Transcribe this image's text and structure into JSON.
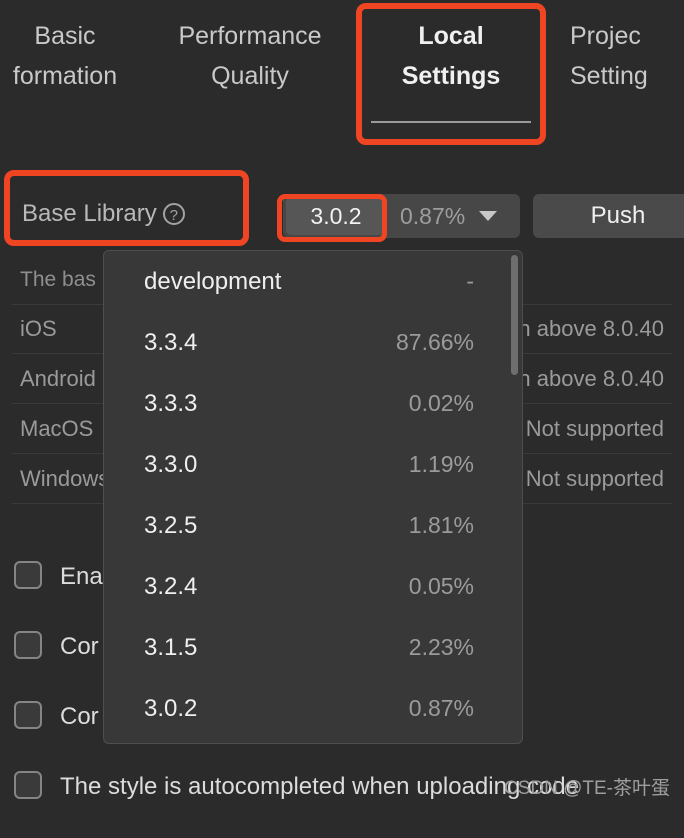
{
  "colors": {
    "background": "#2b2b2b",
    "panel": "#383838",
    "annotation_red": "#f04523",
    "button": "#4a4a4a",
    "chip": "#565656",
    "text_primary": "#efefef",
    "text_secondary": "#9b9b9b"
  },
  "tabs": [
    {
      "label_line1": "Basic",
      "label_line2": "formation",
      "active": false
    },
    {
      "label_line1": "Performance",
      "label_line2": "Quality",
      "active": false
    },
    {
      "label_line1": "Local",
      "label_line2": "Settings",
      "active": true
    },
    {
      "label_line1": "Projec",
      "label_line2": "Setting",
      "active": false
    }
  ],
  "base_library": {
    "label": "Base Library",
    "help_icon": "question-mark-circle-icon",
    "selected_version": "3.0.2",
    "selected_share": "0.87%",
    "caret_icon": "chevron-down-icon",
    "push_label": "Push"
  },
  "description": "The bas",
  "support_table": {
    "rows": [
      {
        "platform": "iOS",
        "support": "on above 8.0.40"
      },
      {
        "platform": "Android",
        "support": "on above 8.0.40"
      },
      {
        "platform": "MacOS",
        "support": "Not supported"
      },
      {
        "platform": "Windows",
        "support": "Not supported"
      }
    ]
  },
  "checkboxes": [
    {
      "label": "Ena",
      "checked": false
    },
    {
      "label": "Cor",
      "checked": false
    },
    {
      "label": "Cor",
      "checked": false
    },
    {
      "label": "The style is autocompleted when uploading code",
      "checked": false
    }
  ],
  "dropdown": {
    "items": [
      {
        "version": "development",
        "share": "-"
      },
      {
        "version": "3.3.4",
        "share": "87.66%"
      },
      {
        "version": "3.3.3",
        "share": "0.02%"
      },
      {
        "version": "3.3.0",
        "share": "1.19%"
      },
      {
        "version": "3.2.5",
        "share": "1.81%"
      },
      {
        "version": "3.2.4",
        "share": "0.05%"
      },
      {
        "version": "3.1.5",
        "share": "2.23%"
      },
      {
        "version": "3.0.2",
        "share": "0.87%"
      }
    ]
  },
  "watermark": "CSDN @TE-茶叶蛋"
}
